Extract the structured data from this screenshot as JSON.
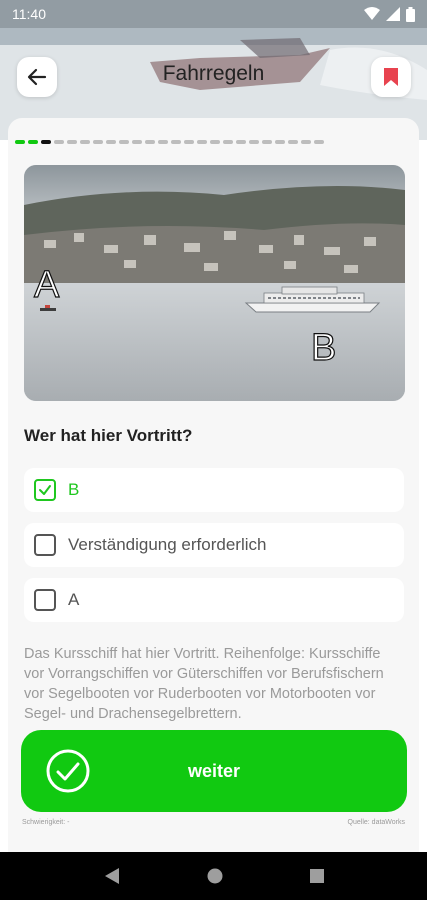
{
  "status_bar": {
    "time": "11:40"
  },
  "header": {
    "title": "Fahrregeln"
  },
  "progress": {
    "total": 24,
    "current": 3,
    "done": 2
  },
  "photo": {
    "label_a": "A",
    "label_b": "B"
  },
  "question": "Wer hat hier Vortritt?",
  "options": [
    {
      "label": "B",
      "checked": true
    },
    {
      "label": "Verständigung erforderlich",
      "checked": false
    },
    {
      "label": "A",
      "checked": false
    }
  ],
  "explanation": "Das Kursschiff hat hier Vortritt.  Reihenfolge: Kursschiffe vor Vorrangschiffen vor Güterschiffen vor Berufsfischern vor Segelbooten vor Ruderbooten vor Motorbooten vor Segel- und Drachensegelbrettern.",
  "action": {
    "label": "weiter"
  },
  "footer": {
    "difficulty": "Schwierigkeit: -",
    "source": "Quelle: dataWorks"
  },
  "colors": {
    "accent": "#11c911",
    "bookmark": "#e8434f"
  },
  "icons": [
    "back-arrow-icon",
    "bookmark-icon",
    "checkmark-icon",
    "wifi-icon",
    "signal-icon",
    "battery-icon"
  ]
}
